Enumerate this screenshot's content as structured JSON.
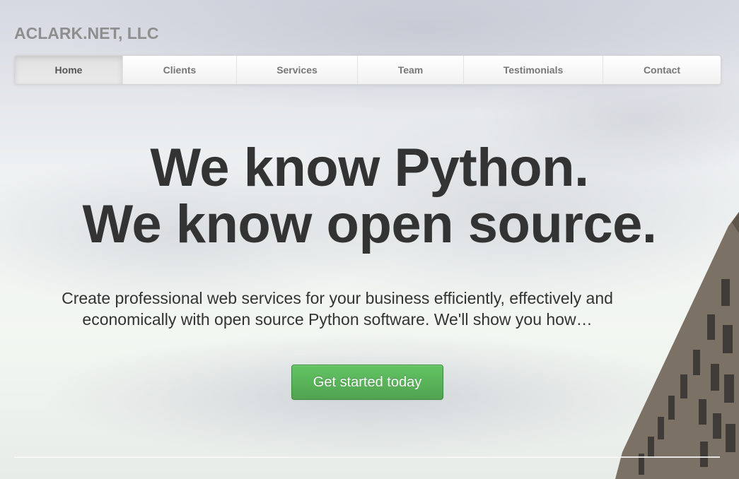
{
  "brand": {
    "name": "ACLARK.NET, LLC"
  },
  "nav": {
    "items": [
      {
        "label": "Home",
        "active": true
      },
      {
        "label": "Clients"
      },
      {
        "label": "Services"
      },
      {
        "label": "Team"
      },
      {
        "label": "Testimonials"
      },
      {
        "label": "Contact"
      }
    ]
  },
  "hero": {
    "headline_line1": "We know Python.",
    "headline_line2": "We know open source.",
    "lead_line1": "Create professional web services for your business efficiently, effectively and",
    "lead_line2": "economically with open source Python software. We'll show you how…",
    "cta_label": "Get started today"
  },
  "colors": {
    "cta": "#51a351",
    "text": "#333333",
    "brand": "#8e8e8e"
  }
}
